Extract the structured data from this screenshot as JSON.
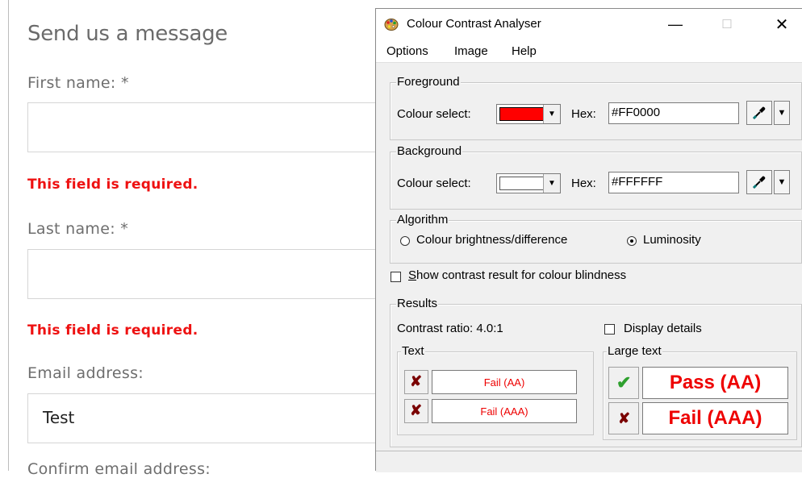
{
  "form": {
    "title": "Send us a message",
    "first_name_label": "First name:",
    "last_name_label": "Last name:",
    "required_marker": "*",
    "error_text": "This field is required.",
    "email_label": "Email address:",
    "email_value": "Test",
    "confirm_email_label": "Confirm email address:"
  },
  "window": {
    "title": "Colour Contrast Analyser",
    "minimize_glyph": "—",
    "maximize_glyph": "☐",
    "close_glyph": "✕",
    "menu": [
      "Options",
      "Image",
      "Help"
    ]
  },
  "foreground": {
    "legend": "Foreground",
    "colour_select_label": "Colour select:",
    "hex_label": "Hex:",
    "hex_value": "#FF0000",
    "swatch_color": "#FF0000"
  },
  "background": {
    "legend": "Background",
    "colour_select_label": "Colour select:",
    "hex_label": "Hex:",
    "hex_value": "#FFFFFF",
    "swatch_color": "#FFFFFF"
  },
  "algorithm": {
    "legend": "Algorithm",
    "option_brightness": "Colour brightness/difference",
    "option_luminosity": "Luminosity",
    "selected": "Luminosity"
  },
  "colour_blindness": {
    "underlined_letter": "S",
    "label_rest": "how contrast result for colour blindness",
    "checked": false
  },
  "results": {
    "legend": "Results",
    "contrast_ratio": "Contrast ratio: 4.0:1",
    "display_details_label": "Display details",
    "text_legend": "Text",
    "large_text_legend": "Large text",
    "text_aa": "Fail (AA)",
    "text_aaa": "Fail (AAA)",
    "large_aa": "Pass (AA)",
    "large_aaa": "Fail (AAA)",
    "fail_glyph": "✘",
    "pass_glyph": "✔"
  },
  "colors": {
    "error_red": "#EE1111",
    "fail_mark": "#7A0000",
    "pass_mark": "#2EA02E"
  }
}
